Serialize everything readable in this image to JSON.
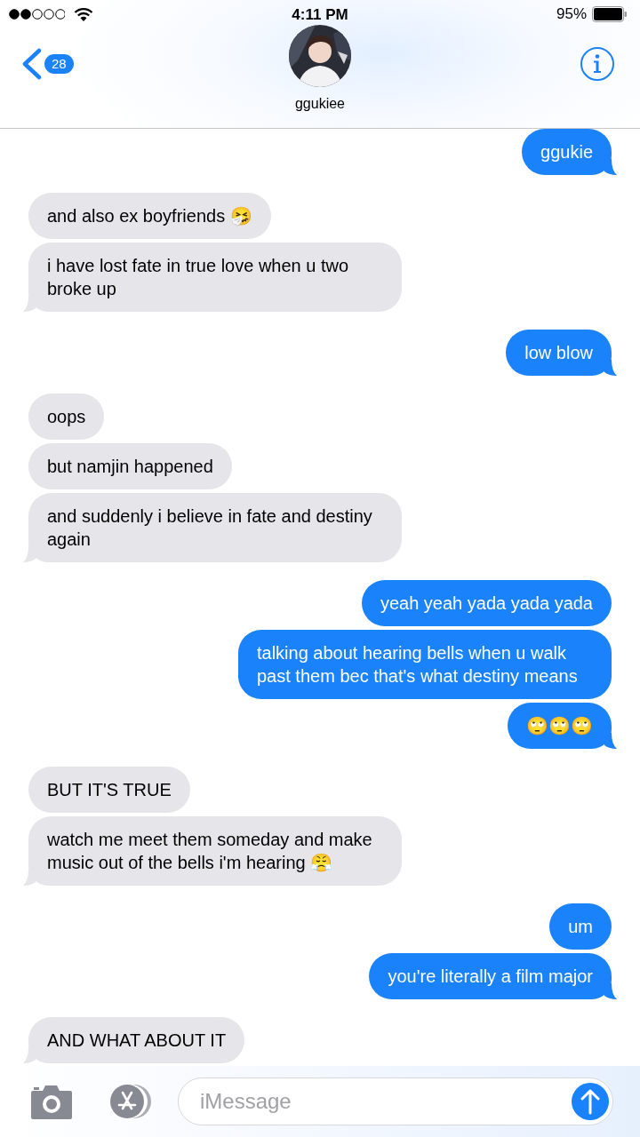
{
  "status_bar": {
    "time": "4:11 PM",
    "battery": "95%"
  },
  "header": {
    "back_badge": "28",
    "contact_name": "ggukiee"
  },
  "groups": [
    {
      "kind": "sent",
      "messages": [
        {
          "text": "ggukie"
        }
      ]
    },
    {
      "kind": "received",
      "messages": [
        {
          "text": "and also ex boyfriends 🤧"
        },
        {
          "text": "i have lost fate in true love when u two broke up"
        }
      ]
    },
    {
      "kind": "sent",
      "messages": [
        {
          "text": "low blow"
        }
      ]
    },
    {
      "kind": "received",
      "messages": [
        {
          "text": "oops"
        },
        {
          "text": "but namjin happened"
        },
        {
          "text": "and suddenly i believe in fate and destiny again"
        }
      ]
    },
    {
      "kind": "sent",
      "messages": [
        {
          "text": "yeah yeah yada yada yada"
        },
        {
          "text": "talking about hearing bells when u walk past them bec that's what destiny means"
        },
        {
          "text": "🙄🙄🙄"
        }
      ]
    },
    {
      "kind": "received",
      "messages": [
        {
          "text": "BUT IT'S TRUE"
        },
        {
          "text": "watch me meet them someday and make music out of the bells i'm hearing 😤"
        }
      ]
    },
    {
      "kind": "sent",
      "messages": [
        {
          "text": "um"
        },
        {
          "text": "you're literally a film major"
        }
      ]
    },
    {
      "kind": "received",
      "messages": [
        {
          "text": "AND WHAT ABOUT IT"
        }
      ]
    }
  ],
  "input": {
    "placeholder": "iMessage"
  }
}
